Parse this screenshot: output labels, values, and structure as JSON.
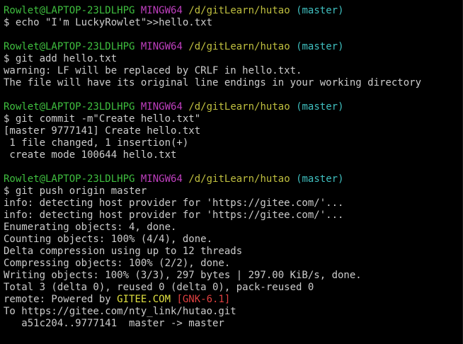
{
  "colors": {
    "background": "#000000",
    "prompt_user": "#3fbf3f",
    "prompt_mingw": "#bf3fbf",
    "prompt_path": "#bfbf3f",
    "prompt_branch": "#3fbfbf",
    "text": "#cccccc",
    "gitee_highlight": "#e0e040",
    "gnk_highlight": "#e04040"
  },
  "prompt": {
    "user_host": "Rowlet@LAPTOP-23LDLHPG",
    "env": "MINGW64",
    "path": "/d/gitLearn/hutao",
    "branch": "(master)"
  },
  "blocks": [
    {
      "command": "$ echo \"I'm LuckyRowlet\">>hello.txt",
      "output": []
    },
    {
      "command": "$ git add hello.txt",
      "output": [
        "warning: LF will be replaced by CRLF in hello.txt.",
        "The file will have its original line endings in your working directory"
      ]
    },
    {
      "command": "$ git commit -m\"Create hello.txt\"",
      "output": [
        "[master 9777141] Create hello.txt",
        " 1 file changed, 1 insertion(+)",
        " create mode 100644 hello.txt"
      ]
    },
    {
      "command": "$ git push origin master",
      "output": [
        "info: detecting host provider for 'https://gitee.com/'...",
        "info: detecting host provider for 'https://gitee.com/'...",
        "Enumerating objects: 4, done.",
        "Counting objects: 100% (4/4), done.",
        "Delta compression using up to 12 threads",
        "Compressing objects: 100% (2/2), done.",
        "Writing objects: 100% (3/3), 297 bytes | 297.00 KiB/s, done.",
        "Total 3 (delta 0), reused 0 (delta 0), pack-reused 0"
      ],
      "remote_line": {
        "prefix": "remote: Powered by ",
        "gitee": "GITEE.COM",
        "space": " ",
        "gnk": "[GNK-6.1]"
      },
      "tail": [
        "To https://gitee.com/nty_link/hutao.git",
        "   a51c204..9777141  master -> master"
      ]
    }
  ]
}
